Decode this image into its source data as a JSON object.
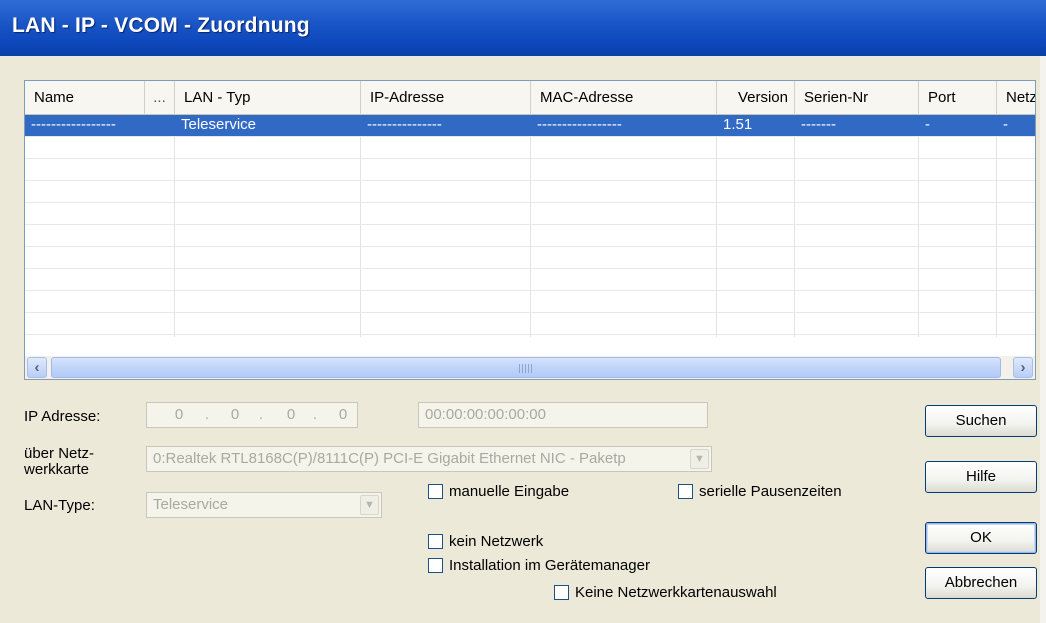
{
  "window": {
    "title": "LAN - IP - VCOM - Zuordnung"
  },
  "table": {
    "columns": [
      "Name",
      "...",
      "LAN - Typ",
      "IP-Adresse",
      "MAC-Adresse",
      "Version",
      "Serien-Nr",
      "Port",
      "Netz"
    ],
    "rows": [
      [
        "-----------------",
        "",
        "Teleservice",
        "---------------",
        "-----------------",
        "1.51",
        "-------",
        "-",
        "-"
      ]
    ],
    "selected_row": 0
  },
  "form": {
    "ip_label": "IP Adresse:",
    "ip_octets": [
      "0",
      "0",
      "0",
      "0"
    ],
    "mac_value": "00:00:00:00:00:00",
    "netcard_label_line1": "über Netz-",
    "netcard_label_line2": "werkkarte",
    "netcard_value": "0:Realtek RTL8168C(P)/8111C(P) PCI-E Gigabit Ethernet NIC - Paketp",
    "lantype_label": "LAN-Type:",
    "lantype_value": "Teleservice"
  },
  "checkboxes": {
    "manual": "manuelle Eingabe",
    "serial_pause": "serielle Pausenzeiten",
    "no_network": "kein Netzwerk",
    "install_device_manager": "Installation im Gerätemanager",
    "no_netcard_select": "Keine Netzwerkkartenauswahl"
  },
  "buttons": {
    "search": "Suchen",
    "help": "Hilfe",
    "ok": "OK",
    "cancel": "Abbrechen"
  }
}
